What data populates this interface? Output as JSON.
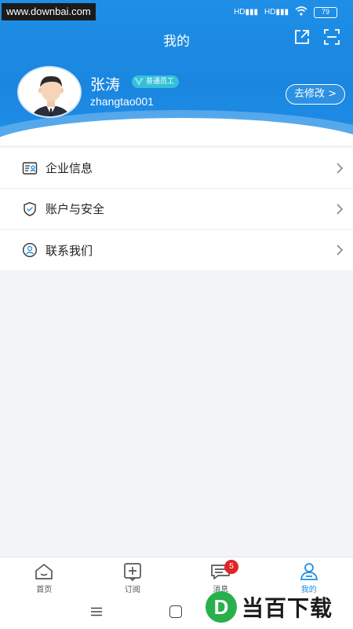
{
  "watermark": "www.downbai.com",
  "status": {
    "network1": "HD",
    "network2": "HD",
    "battery": "79"
  },
  "header": {
    "title": "我的"
  },
  "profile": {
    "name": "张涛",
    "badge": "普通员工",
    "user_id": "zhangtao001",
    "edit_label": "去修改 >"
  },
  "menu": [
    {
      "label": "企业信息",
      "icon": "id-card-icon"
    },
    {
      "label": "账户与安全",
      "icon": "shield-icon"
    },
    {
      "label": "联系我们",
      "icon": "contact-icon"
    }
  ],
  "tabs": [
    {
      "label": "首页",
      "icon": "home-icon"
    },
    {
      "label": "订阅",
      "icon": "subscribe-icon"
    },
    {
      "label": "消息",
      "icon": "message-icon",
      "badge": "5"
    },
    {
      "label": "我的",
      "icon": "person-icon",
      "active": true
    }
  ],
  "logo_watermark": {
    "letter": "D",
    "text": "当百下载"
  },
  "colors": {
    "primary": "#1e8ee6",
    "badge_red": "#e02525",
    "teal_badge": "#34c1d8"
  }
}
